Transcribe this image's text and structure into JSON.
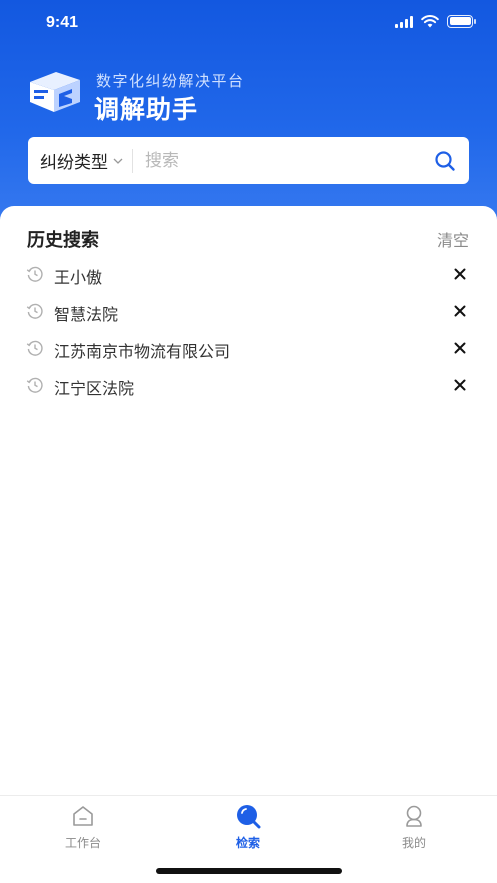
{
  "status": {
    "time": "9:41"
  },
  "brand": {
    "subtitle": "数字化纠纷解决平台",
    "title": "调解助手"
  },
  "search": {
    "filter_label": "纠纷类型",
    "placeholder": "搜索",
    "value": ""
  },
  "history": {
    "title": "历史搜索",
    "clear_label": "清空",
    "items": [
      {
        "label": "王小傲"
      },
      {
        "label": "智慧法院"
      },
      {
        "label": "江苏南京市物流有限公司"
      },
      {
        "label": "江宁区法院"
      }
    ]
  },
  "tabs": [
    {
      "label": "工作台",
      "icon": "workbench-icon",
      "active": false
    },
    {
      "label": "检索",
      "icon": "search-tab-icon",
      "active": true
    },
    {
      "label": "我的",
      "icon": "profile-icon",
      "active": false
    }
  ],
  "colors": {
    "brand_blue": "#1e5fe6",
    "header_top": "#1358e0",
    "header_bottom": "#3a7cf0",
    "muted_text": "#8a8a8a"
  }
}
